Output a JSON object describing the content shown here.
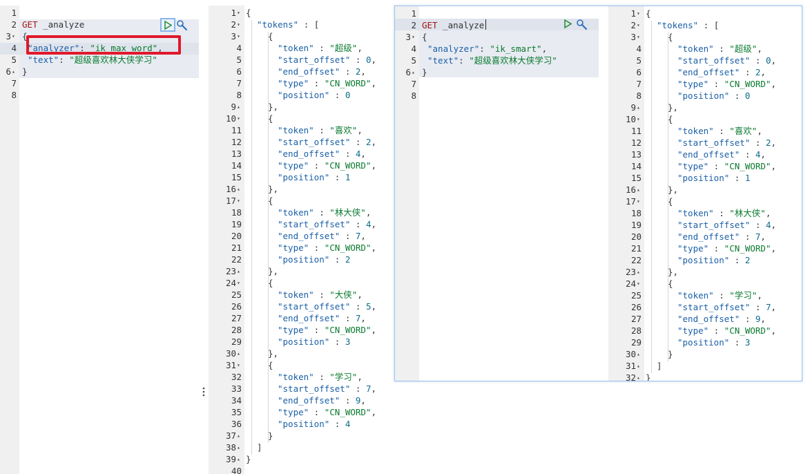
{
  "left_request": {
    "line_numbers": [
      "1",
      "2",
      "3",
      "4",
      "5",
      "6",
      "7",
      "8"
    ],
    "method": "GET",
    "url": "_analyze",
    "lines": [
      {
        "n": "1",
        "text": ""
      },
      {
        "n": "2",
        "text": "GET _analyze"
      },
      {
        "n": "3",
        "text": "{"
      },
      {
        "n": "4",
        "key": "\"analyzer\"",
        "sep": ": ",
        "val": "\"ik_max_word\"",
        "tail": ","
      },
      {
        "n": "5",
        "key": "\"text\"",
        "sep": ": ",
        "val": "\"超级喜欢林大侠学习\"",
        "tail": ""
      },
      {
        "n": "6",
        "text": "}"
      },
      {
        "n": "7",
        "text": ""
      },
      {
        "n": "8",
        "text": ""
      }
    ]
  },
  "left_response": {
    "line_numbers": [
      "1",
      "2",
      "3",
      "4",
      "5",
      "6",
      "7",
      "8",
      "9",
      "10",
      "11",
      "12",
      "13",
      "14",
      "15",
      "16",
      "17",
      "18",
      "19",
      "20",
      "21",
      "22",
      "23",
      "24",
      "25",
      "26",
      "27",
      "28",
      "29",
      "30",
      "31",
      "32",
      "33",
      "34",
      "35",
      "36",
      "37",
      "38",
      "39",
      "40"
    ],
    "tokens": [
      {
        "token": "\"超级\"",
        "start_offset": "0",
        "end_offset": "2",
        "type": "\"CN_WORD\"",
        "position": "0"
      },
      {
        "token": "\"喜欢\"",
        "start_offset": "2",
        "end_offset": "4",
        "type": "\"CN_WORD\"",
        "position": "1"
      },
      {
        "token": "\"林大侠\"",
        "start_offset": "4",
        "end_offset": "7",
        "type": "\"CN_WORD\"",
        "position": "2"
      },
      {
        "token": "\"大侠\"",
        "start_offset": "5",
        "end_offset": "7",
        "type": "\"CN_WORD\"",
        "position": "3"
      },
      {
        "token": "\"学习\"",
        "start_offset": "7",
        "end_offset": "9",
        "type": "\"CN_WORD\"",
        "position": "4"
      }
    ]
  },
  "right_request": {
    "method": "GET",
    "url": "_analyze",
    "lines": [
      {
        "n": "1",
        "text": ""
      },
      {
        "n": "2",
        "text": "GET _analyze"
      },
      {
        "n": "3",
        "text": "{"
      },
      {
        "n": "4",
        "key": "\"analyzer\"",
        "sep": ": ",
        "val": "\"ik_smart\"",
        "tail": ","
      },
      {
        "n": "5",
        "key": "\"text\"",
        "sep": ": ",
        "val": "\"超级喜欢林大侠学习\"",
        "tail": ""
      },
      {
        "n": "6",
        "text": "}"
      },
      {
        "n": "7",
        "text": ""
      },
      {
        "n": "8",
        "text": ""
      }
    ]
  },
  "right_response": {
    "tokens": [
      {
        "token": "\"超级\"",
        "start_offset": "0",
        "end_offset": "2",
        "type": "\"CN_WORD\"",
        "position": "0"
      },
      {
        "token": "\"喜欢\"",
        "start_offset": "2",
        "end_offset": "4",
        "type": "\"CN_WORD\"",
        "position": "1"
      },
      {
        "token": "\"林大侠\"",
        "start_offset": "4",
        "end_offset": "7",
        "type": "\"CN_WORD\"",
        "position": "2"
      },
      {
        "token": "\"学习\"",
        "start_offset": "7",
        "end_offset": "9",
        "type": "\"CN_WORD\"",
        "position": "3"
      }
    ]
  },
  "labels": {
    "tokens_key": "\"tokens\"",
    "token_key": "\"token\"",
    "start_key": "\"start_offset\"",
    "end_key": "\"end_offset\"",
    "type_key": "\"type\"",
    "position_key": "\"position\""
  },
  "icons": {
    "play": "play-icon",
    "wrench": "wrench-icon",
    "more": "vertical-ellipsis-icon"
  },
  "colors": {
    "highlight_box": "#e0182b",
    "selected_border": "#9ec3ef"
  }
}
